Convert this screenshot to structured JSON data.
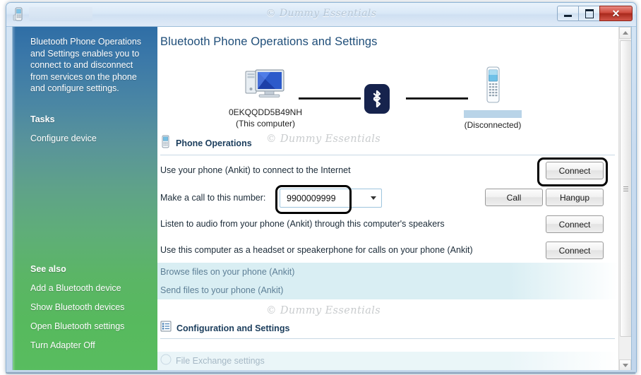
{
  "window": {
    "watermark": "© Dummy Essentials",
    "icon": "phone-icon",
    "controls": {
      "minimize": "Minimize",
      "maximize": "Maximize",
      "close": "Close"
    }
  },
  "sidebar": {
    "description": "Bluetooth Phone Operations and Settings enables you to connect to and disconnect from services on the phone and configure settings.",
    "tasks_heading": "Tasks",
    "tasks": [
      {
        "label": "Configure device"
      }
    ],
    "see_also_heading": "See also",
    "see_also": [
      {
        "label": "Add a Bluetooth device"
      },
      {
        "label": "Show Bluetooth devices"
      },
      {
        "label": "Open Bluetooth settings"
      },
      {
        "label": "Turn Adapter Off"
      }
    ],
    "gradient_top": "#2f6ea6",
    "gradient_bottom": "#58bd5f"
  },
  "main": {
    "page_title": "Bluetooth Phone Operations and Settings",
    "diagram": {
      "computer": {
        "icon": "desktop-computer-icon",
        "name": "0EKQQDD5B49NH",
        "caption": "(This computer)"
      },
      "bluetooth": {
        "icon": "bluetooth-icon",
        "color": "#16234d"
      },
      "phone": {
        "icon": "mobile-phone-icon",
        "name_redacted": true,
        "caption": "(Disconnected)"
      }
    },
    "phone_operations": {
      "icon": "mobile-phone-icon",
      "title": "Phone Operations",
      "watermark": "© Dummy Essentials",
      "rows": [
        {
          "text": "Use your phone (Ankit) to connect to the Internet",
          "button": "Connect",
          "highlighted_button": true,
          "muted": false
        },
        {
          "text": "Make a call to this number:",
          "combo_value": "9900009999",
          "combo_highlighted": true,
          "button_call": "Call",
          "button_hangup": "Hangup",
          "muted": false
        },
        {
          "text": "Listen to audio from your phone (Ankit) through this computer's speakers",
          "button": "Connect",
          "muted": false
        },
        {
          "text": "Use this computer as a headset or speakerphone for calls on your phone (Ankit)",
          "button": "Connect",
          "muted": false
        },
        {
          "text": "Browse files on your phone (Ankit)",
          "muted": true,
          "row_highlight": true
        },
        {
          "text": "Send files to your phone (Ankit)",
          "muted": true,
          "row_highlight": true
        }
      ]
    },
    "configuration": {
      "icon": "settings-list-icon",
      "title": "Configuration and Settings",
      "watermark": "© Dummy Essentials"
    }
  },
  "scrollbar": {
    "up_arrow": "scroll-up-icon",
    "down_arrow": "scroll-down-icon",
    "thumb": "scroll-thumb"
  }
}
